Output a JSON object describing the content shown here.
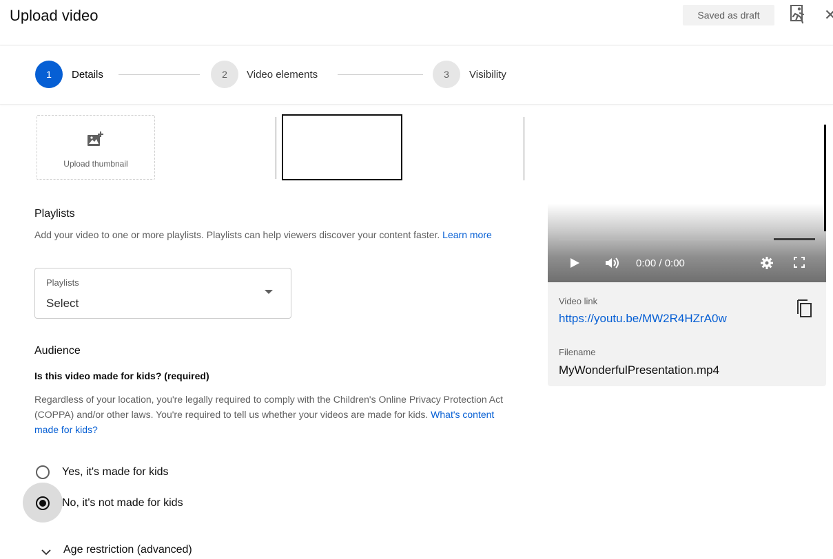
{
  "header": {
    "title": "Upload video",
    "draft_status": "Saved as draft",
    "close_glyph": "✕"
  },
  "stepper": {
    "steps": [
      {
        "number": "1",
        "label": "Details",
        "active": true
      },
      {
        "number": "2",
        "label": "Video elements",
        "active": false
      },
      {
        "number": "3",
        "label": "Visibility",
        "active": false
      }
    ]
  },
  "thumbnail": {
    "upload_label": "Upload thumbnail"
  },
  "playlists": {
    "title": "Playlists",
    "description": "Add your video to one or more playlists. Playlists can help viewers discover your content faster.",
    "learn_more": "Learn more",
    "field_label": "Playlists",
    "field_value": "Select"
  },
  "audience": {
    "title": "Audience",
    "question": "Is this video made for kids? (required)",
    "description": "Regardless of your location, you're legally required to comply with the Children's Online Privacy Protection Act (COPPA) and/or other laws. You're required to tell us whether your videos are made for kids.",
    "help_link": "What's content made for kids?",
    "options": [
      {
        "label": "Yes, it's made for kids",
        "selected": false
      },
      {
        "label": "No, it's not made for kids",
        "selected": true
      }
    ],
    "age_restriction_label": "Age restriction (advanced)"
  },
  "preview": {
    "time": "0:00 / 0:00",
    "progress_buffered_fraction": 0.16
  },
  "video_info": {
    "link_label": "Video link",
    "link_url": "https://youtu.be/MW2R4HZrA0w",
    "filename_label": "Filename",
    "filename": "MyWonderfulPresentation.mp4"
  },
  "colors": {
    "accent": "#065fd4",
    "text_primary": "#0d0d0d",
    "text_secondary": "#606060"
  }
}
